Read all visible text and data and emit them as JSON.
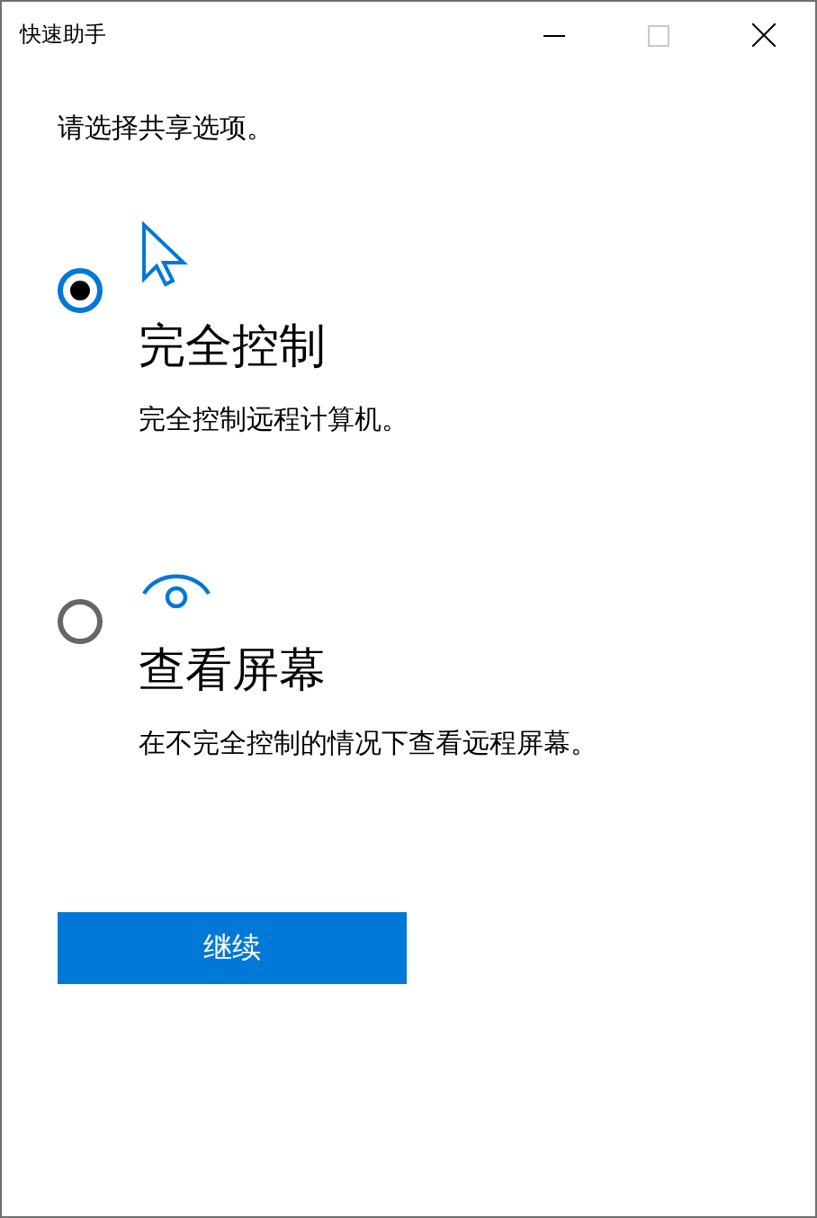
{
  "window": {
    "title": "快速助手",
    "maximize_disabled": true
  },
  "prompt": "请选择共享选项。",
  "options": [
    {
      "kind": "cursor",
      "title": "完全控制",
      "description": "完全控制远程计算机。",
      "selected": true
    },
    {
      "kind": "eye",
      "title": "查看屏幕",
      "description": "在不完全控制的情况下查看远程屏幕。",
      "selected": false
    }
  ],
  "continue_button": "继续"
}
